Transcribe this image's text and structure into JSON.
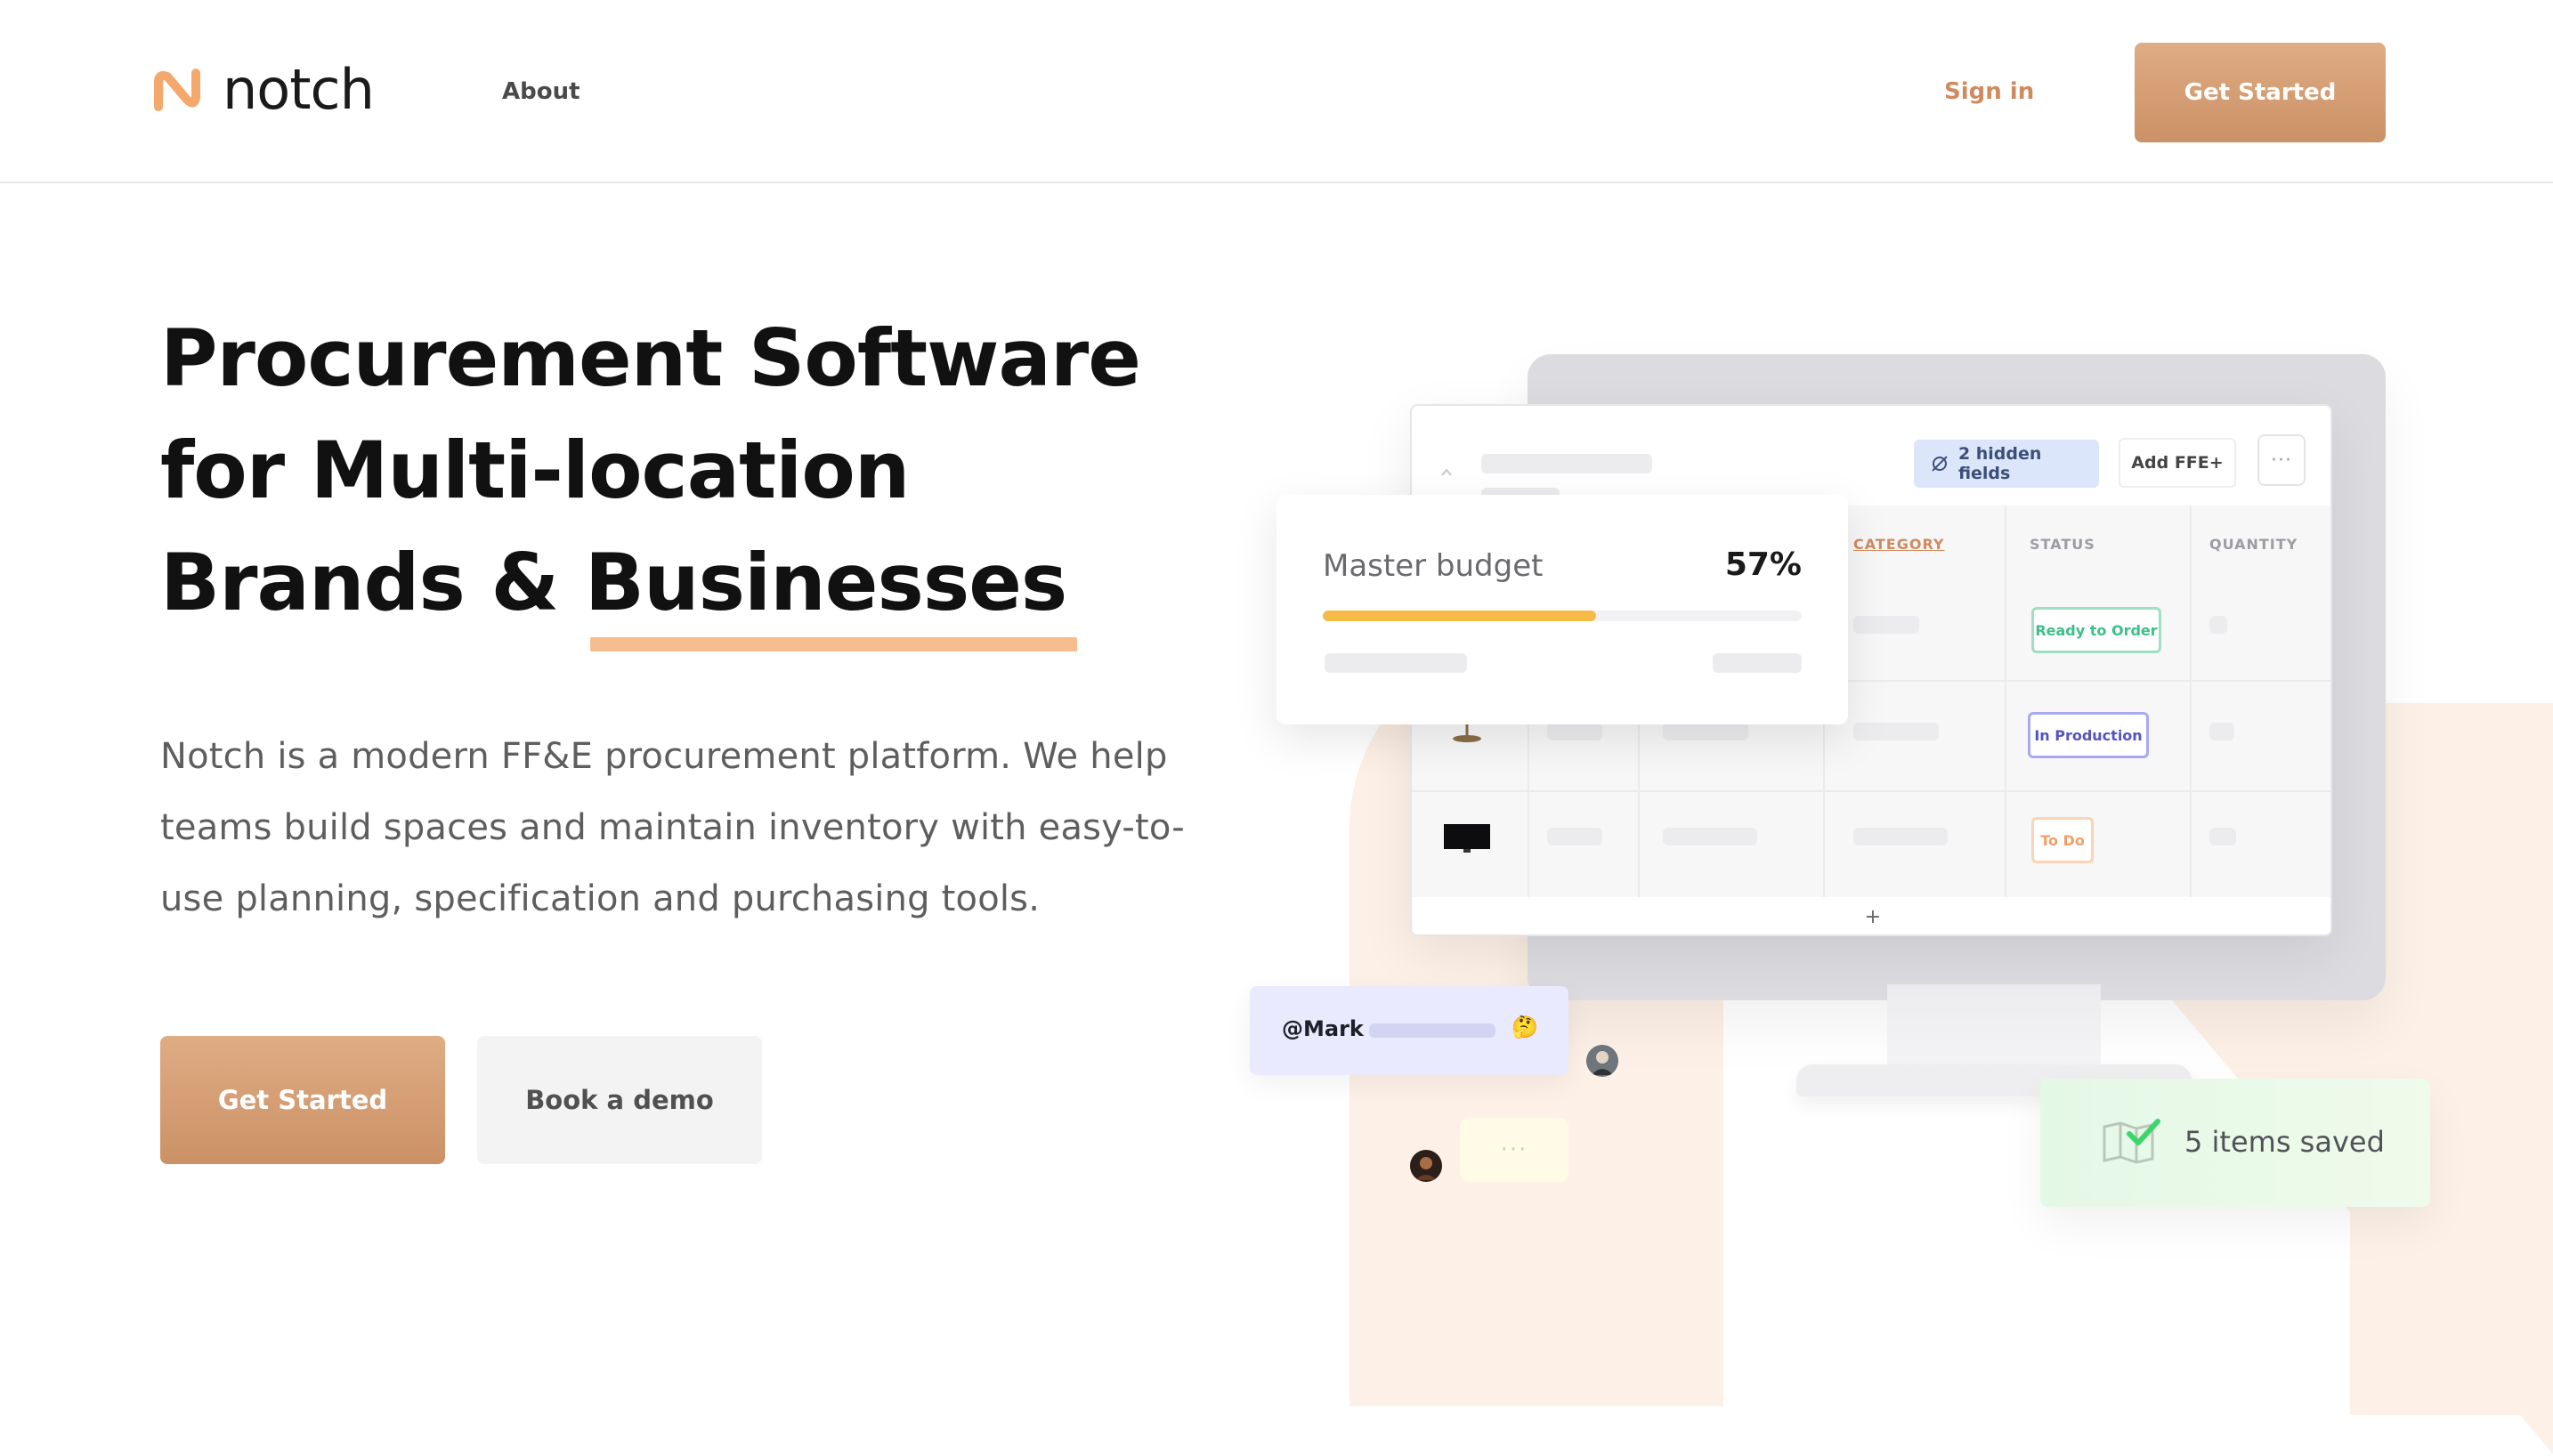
{
  "brand": {
    "name": "notch",
    "accent": "#d08a5f",
    "cta_gradient": [
      "#dfac84",
      "#cb9166"
    ]
  },
  "nav": {
    "about": "About",
    "sign_in": "Sign in",
    "get_started": "Get Started"
  },
  "hero": {
    "headline_line1": "Procurement Software",
    "headline_line2": "for Multi-location",
    "headline_line3_prefix": "Brands & ",
    "headline_highlight": "Businesses",
    "subtext_line1": "Notch is a modern FF&E procurement platform. We help",
    "subtext_line2": "teams build spaces and maintain inventory with easy-to-",
    "subtext_line3": "use planning, specification and purchasing tools.",
    "primary_cta": "Get Started",
    "secondary_cta": "Book a demo"
  },
  "illustration": {
    "toolbar": {
      "hidden_fields": "2 hidden fields",
      "add_button": "Add FFE+",
      "more_icon": "ellipsis-icon"
    },
    "columns": {
      "category": "CATEGORY",
      "status": "STATUS",
      "quantity": "QUANTITY"
    },
    "statuses": {
      "ready": {
        "label": "Ready to Order",
        "color": "#3dbf88"
      },
      "production": {
        "label": "In Production",
        "color": "#5452c7"
      },
      "todo": {
        "label": "To Do",
        "color": "#f19f69"
      }
    },
    "add_row": "+",
    "budget": {
      "title": "Master budget",
      "percent_label": "57%",
      "progress": 0.57
    },
    "mention": {
      "handle": "@Mark",
      "emoji": "🤔"
    },
    "typing": "···",
    "saved": {
      "label": "5 items saved"
    }
  }
}
